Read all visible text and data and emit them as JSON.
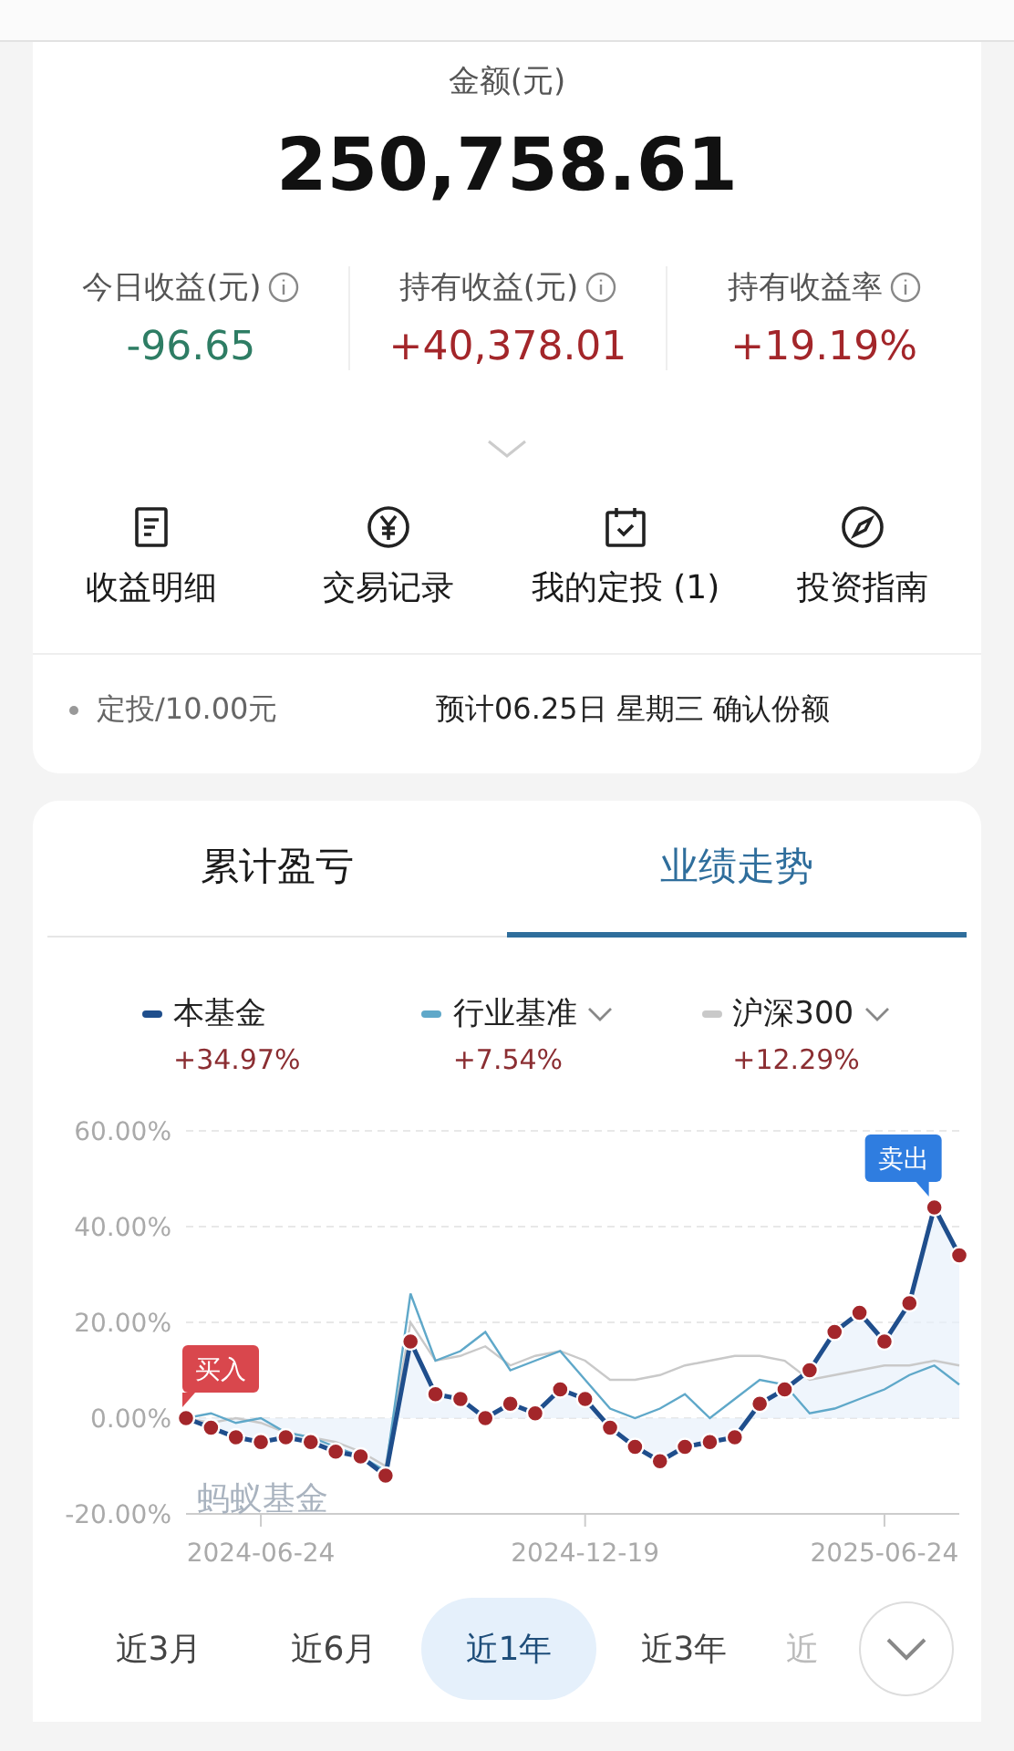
{
  "summary": {
    "amount_label": "金额(元)",
    "amount": "250,758.61",
    "stats": [
      {
        "label": "今日收益(元)",
        "value": "-96.65",
        "color": "#2e7d64"
      },
      {
        "label": "持有收益(元)",
        "value": "+40,378.01",
        "color": "#a3262a"
      },
      {
        "label": "持有收益率",
        "value": "+19.19%",
        "color": "#a3262a"
      }
    ],
    "actions": [
      {
        "label": "收益明细"
      },
      {
        "label": "交易记录"
      },
      {
        "label": "我的定投 (1)"
      },
      {
        "label": "投资指南"
      }
    ],
    "plan": {
      "amount": "定投/10.00元",
      "note": "预计06.25日 星期三 确认份额"
    }
  },
  "performance": {
    "tabs": [
      {
        "label": "累计盈亏",
        "selected": false
      },
      {
        "label": "业绩走势",
        "selected": true
      }
    ],
    "legend": [
      {
        "value": "+34.97%",
        "dropdown": false
      },
      {
        "value": "+7.54%",
        "dropdown": true
      },
      {
        "value": "+12.29%",
        "dropdown": true
      }
    ],
    "chart_data": {
      "type": "line",
      "grid": true,
      "categories": [
        null,
        null,
        null,
        "2024-06-24",
        null,
        null,
        null,
        null,
        null,
        null,
        null,
        null,
        null,
        null,
        null,
        null,
        "2024-12-19",
        null,
        null,
        null,
        null,
        null,
        null,
        null,
        null,
        null,
        null,
        null,
        "2025-06-24",
        null,
        null,
        null
      ],
      "ylim": [
        -20,
        60
      ],
      "yticks": [
        {
          "value": 60,
          "label": "60.00%"
        },
        {
          "value": 40,
          "label": "40.00%"
        },
        {
          "value": 20,
          "label": "20.00%"
        },
        {
          "value": 0,
          "label": "0.00%"
        },
        {
          "value": -20,
          "label": "-20.00%"
        }
      ],
      "series": [
        {
          "name": "本基金",
          "color": "#1f4e8c",
          "type": "area",
          "values": [
            0,
            -2,
            -4,
            -5,
            -4,
            -5,
            -7,
            -8,
            -12,
            16,
            5,
            4,
            0,
            3,
            1,
            6,
            4,
            -2,
            -6,
            -9,
            -6,
            -5,
            -4,
            3,
            6,
            10,
            18,
            22,
            16,
            24,
            44,
            34
          ]
        },
        {
          "name": "行业基准",
          "color": "#5fa8c9",
          "type": "line",
          "values": [
            0,
            1,
            -1,
            0,
            -3,
            -4,
            -6,
            -8,
            -11,
            26,
            12,
            14,
            18,
            10,
            12,
            14,
            8,
            2,
            0,
            2,
            5,
            0,
            4,
            8,
            7,
            1,
            2,
            4,
            6,
            9,
            11,
            7
          ]
        },
        {
          "name": "沪深300",
          "color": "#c9c9c9",
          "type": "line",
          "values": [
            0,
            -1,
            0,
            -1,
            -3,
            -4,
            -5,
            -7,
            -10,
            20,
            12,
            13,
            15,
            11,
            13,
            14,
            12,
            8,
            8,
            9,
            11,
            12,
            13,
            13,
            12,
            8,
            9,
            10,
            11,
            11,
            12,
            11
          ]
        }
      ],
      "annotations": [
        "买入",
        "卖出"
      ]
    },
    "chart_mark": "蚂蚁基金",
    "ranges": [
      {
        "label": "近3月",
        "selected": false
      },
      {
        "label": "近6月",
        "selected": false
      },
      {
        "label": "近1年",
        "selected": true
      },
      {
        "label": "近3年",
        "selected": false
      },
      {
        "label": "近",
        "selected": false
      }
    ]
  }
}
